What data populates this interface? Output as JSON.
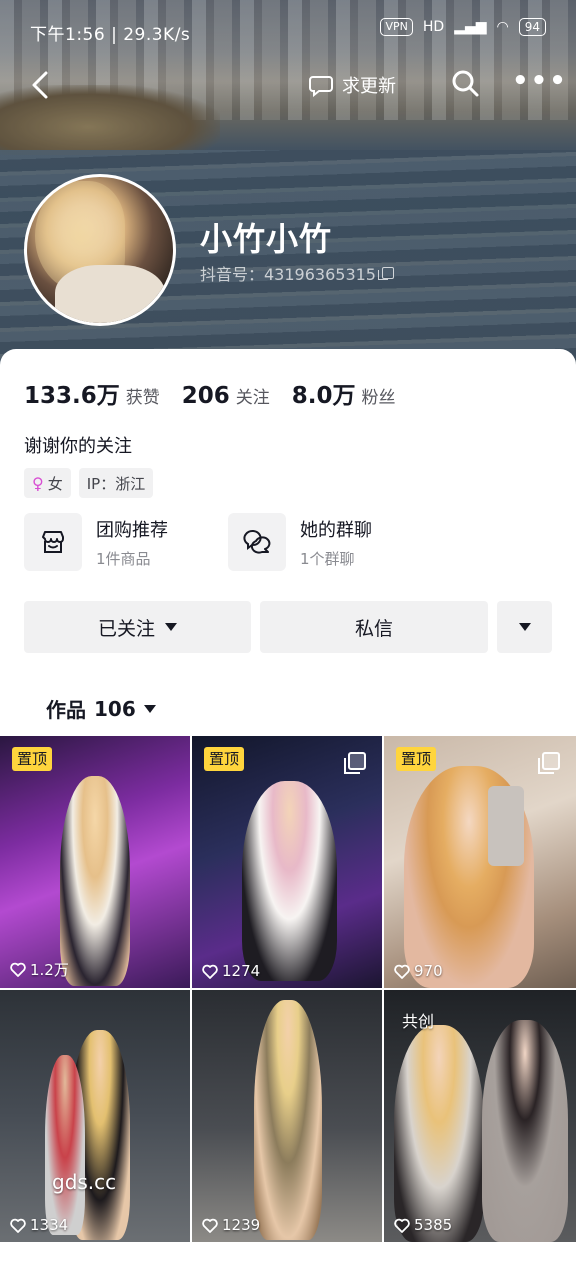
{
  "status_bar": {
    "time_speed": "下午1:56 | 29.3K/s",
    "vpn": "VPN",
    "hd": "HD",
    "battery": "94"
  },
  "nav": {
    "update_label": "求更新"
  },
  "profile": {
    "nickname": "小竹小竹",
    "douyin_id": "抖音号：43196365315"
  },
  "stats": [
    {
      "value": "133.6万",
      "label": "获赞"
    },
    {
      "value": "206",
      "label": "关注"
    },
    {
      "value": "8.0万",
      "label": "粉丝"
    }
  ],
  "bio": "谢谢你的关注",
  "tags": {
    "gender": "女",
    "ip": "IP：浙江"
  },
  "entries": [
    {
      "title": "团购推荐",
      "subtitle": "1件商品",
      "icon": "shop-icon"
    },
    {
      "title": "她的群聊",
      "subtitle": "1个群聊",
      "icon": "chat-group-icon"
    }
  ],
  "actions": {
    "follow_label": "已关注",
    "message_label": "私信"
  },
  "works_tab": {
    "label": "作品",
    "count": "106"
  },
  "videos": [
    {
      "badge": "置顶",
      "likes": "1.2万",
      "multi": false,
      "cocreate": ""
    },
    {
      "badge": "置顶",
      "likes": "1274",
      "multi": true,
      "cocreate": ""
    },
    {
      "badge": "置顶",
      "likes": "970",
      "multi": true,
      "cocreate": ""
    },
    {
      "badge": "",
      "likes": "1334",
      "multi": false,
      "cocreate": "",
      "watermark": "gds.cc"
    },
    {
      "badge": "",
      "likes": "1239",
      "multi": false,
      "cocreate": ""
    },
    {
      "badge": "",
      "likes": "5385",
      "multi": false,
      "cocreate": "共创"
    }
  ],
  "colors": {
    "accent_badge": "#ffd53d",
    "text_primary": "#161823",
    "female": "#d84fd3"
  }
}
